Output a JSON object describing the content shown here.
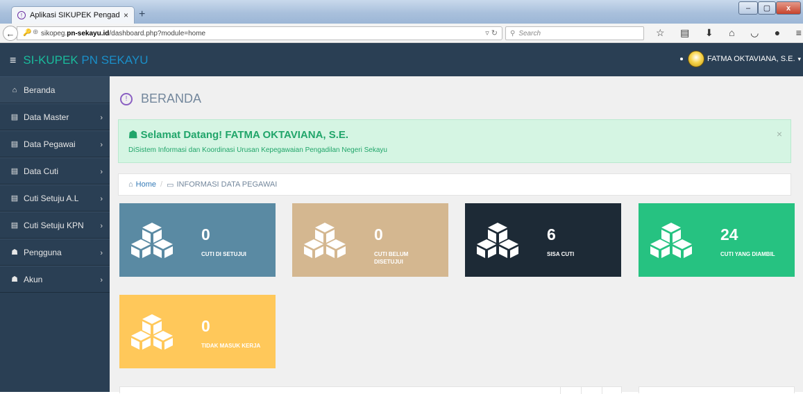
{
  "browser": {
    "tab_title": "Aplikasi SIKUPEK Pengadila...",
    "tab_close": "×",
    "new_tab": "+",
    "url_plain": "sikopeg.",
    "url_bold": "pn-sekayu.id",
    "url_rest": "/dashboard.php?module=home",
    "search_placeholder": "Search",
    "win_min": "–",
    "win_max": "▢",
    "win_close": "x"
  },
  "header": {
    "brand_part1": "SI-KUPEK",
    "brand_part2": " PN SEKAYU",
    "user_name": "FATMA OKTAVIANA, S.E."
  },
  "sidebar": {
    "items": [
      {
        "label": "Beranda",
        "icon": "home-icon"
      },
      {
        "label": "Data Master",
        "icon": "table-icon"
      },
      {
        "label": "Data Pegawai",
        "icon": "table-icon"
      },
      {
        "label": "Data Cuti",
        "icon": "table-icon"
      },
      {
        "label": "Cuti Setuju A.L",
        "icon": "table-icon"
      },
      {
        "label": "Cuti Setuju KPN",
        "icon": "table-icon"
      },
      {
        "label": "Pengguna",
        "icon": "user-icon"
      },
      {
        "label": "Akun",
        "icon": "user-icon"
      }
    ]
  },
  "main": {
    "page_title": "BERANDA",
    "alert_title": "Selamat Datang! FATMA OKTAVIANA, S.E.",
    "alert_text": "DiSistem Informasi dan Koordinasi Urusan Kepegawaian Pengadilan Negeri Sekayu",
    "alert_close": "×",
    "crumb_home": "Home",
    "crumb_current": "INFORMASI DATA PEGAWAI",
    "tiles": [
      {
        "value": "0",
        "label": "CUTI DI SETUJUI",
        "color": "#5a8aa3"
      },
      {
        "value": "0",
        "label": "CUTI BELUM DISETUJUI",
        "color": "#d4b790"
      },
      {
        "value": "6",
        "label": "SISA CUTI",
        "color": "#1d2a36"
      },
      {
        "value": "24",
        "label": "CUTI YANG DIAMBIL",
        "color": "#26c281"
      },
      {
        "value": "0",
        "label": "TIDAK MASUK KERJA",
        "color": "#ffc85a"
      }
    ]
  }
}
